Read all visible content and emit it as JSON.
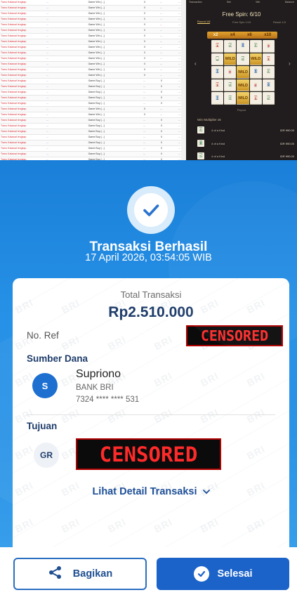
{
  "transaction_table": {
    "rows": [
      {
        "user": "Trans Kalawat lengkap",
        "id": "...",
        "ket": "Game Win [...]",
        "a": "0",
        "b": "...",
        "c": "...",
        "neg": false
      },
      {
        "user": "Trans Kalawat lengkap",
        "id": "...",
        "ket": "Game Win [...]",
        "a": "0",
        "b": "...",
        "c": "...",
        "neg": false
      },
      {
        "user": "Trans Kalawat lengkap",
        "id": "...",
        "ket": "Game Win [...]",
        "a": "0",
        "b": "...",
        "c": "...",
        "neg": false
      },
      {
        "user": "Trans Kalawat lengkap",
        "id": "...",
        "ket": "Game Win [...]",
        "a": "0",
        "b": "...",
        "c": "...",
        "neg": false
      },
      {
        "user": "Trans Kalawat lengkap",
        "id": "...",
        "ket": "Game Win [...]",
        "a": "0",
        "b": "...",
        "c": "...",
        "neg": true
      },
      {
        "user": "Trans Kalawat lengkap",
        "id": "...",
        "ket": "Game Win [...]",
        "a": "0",
        "b": "...",
        "c": "...",
        "neg": false
      },
      {
        "user": "Trans Kalawat lengkap",
        "id": "...",
        "ket": "Game Win [...]",
        "a": "0",
        "b": "...",
        "c": "...",
        "neg": false
      },
      {
        "user": "Trans Kalawat lengkap",
        "id": "...",
        "ket": "Game Win [...]",
        "a": "0",
        "b": "...",
        "c": "...",
        "neg": false
      },
      {
        "user": "Trans Kalawat lengkap",
        "id": "...",
        "ket": "Game Win [...]",
        "a": "0",
        "b": "...",
        "c": "...",
        "neg": false
      },
      {
        "user": "Trans Kalawat lengkap",
        "id": "...",
        "ket": "Game Win [...]",
        "a": "0",
        "b": "...",
        "c": "...",
        "neg": false
      },
      {
        "user": "Trans Kalawat lengkap",
        "id": "...",
        "ket": "Game Win [...]",
        "a": "0",
        "b": "...",
        "c": "...",
        "neg": true
      },
      {
        "user": "Trans Kalawat lengkap",
        "id": "...",
        "ket": "Game Win [...]",
        "a": "0",
        "b": "...",
        "c": "...",
        "neg": false
      },
      {
        "user": "Trans Kalawat lengkap",
        "id": "...",
        "ket": "Game Win [...]",
        "a": "0",
        "b": "...",
        "c": "...",
        "neg": false
      },
      {
        "user": "Trans Kalawat lengkap",
        "id": "...",
        "ket": "Game Win [...]",
        "a": "0",
        "b": "...",
        "c": "...",
        "neg": false
      },
      {
        "user": "Trans Kalawat lengkap",
        "id": "...",
        "ket": "Game Buy [...]",
        "a": "...",
        "b": "0",
        "c": "...",
        "neg": false
      },
      {
        "user": "Trans Kalawat lengkap",
        "id": "...",
        "ket": "Game Buy [...]",
        "a": "...",
        "b": "0",
        "c": "...",
        "neg": false
      },
      {
        "user": "Trans Kalawat lengkap",
        "id": "...",
        "ket": "Game Buy [...]",
        "a": "...",
        "b": "0",
        "c": "...",
        "neg": false
      },
      {
        "user": "Trans Kalawat lengkap",
        "id": "...",
        "ket": "Game Buy [...]",
        "a": "...",
        "b": "0",
        "c": "...",
        "neg": false
      },
      {
        "user": "Trans Kalawat lengkap",
        "id": "...",
        "ket": "Game Buy [...]",
        "a": "...",
        "b": "0",
        "c": "...",
        "neg": false
      },
      {
        "user": "Trans Kalawat lengkap",
        "id": "...",
        "ket": "Game Win [...]",
        "a": "0",
        "b": "...",
        "c": "...",
        "neg": false
      },
      {
        "user": "Trans Kalawat lengkap",
        "id": "...",
        "ket": "Game Win [...]",
        "a": "0",
        "b": "...",
        "c": "...",
        "neg": false
      },
      {
        "user": "Trans Kalawat lengkap",
        "id": "...",
        "ket": "Game Buy [...]",
        "a": "...",
        "b": "0",
        "c": "...",
        "neg": false
      },
      {
        "user": "Trans Kalawat lengkap",
        "id": "...",
        "ket": "Game Buy [...]",
        "a": "...",
        "b": "0",
        "c": "...",
        "neg": false
      },
      {
        "user": "Trans Kalawat lengkap",
        "id": "...",
        "ket": "Game Buy [...]",
        "a": "...",
        "b": "0",
        "c": "...",
        "neg": false
      },
      {
        "user": "Trans Kalawat lengkap",
        "id": "...",
        "ket": "Game Buy [...]",
        "a": "...",
        "b": "0",
        "c": "...",
        "neg": false
      },
      {
        "user": "Trans Kalawat lengkap",
        "id": "...",
        "ket": "Game Buy [...]",
        "a": "...",
        "b": "0",
        "c": "...",
        "neg": false
      },
      {
        "user": "Trans Kalawat lengkap",
        "id": "...",
        "ket": "Game Buy [...]",
        "a": "...",
        "b": "0",
        "c": "...",
        "neg": false
      },
      {
        "user": "Trans Kalawat lengkap",
        "id": "...",
        "ket": "Game Buy [...]",
        "a": "...",
        "b": "0",
        "c": "...",
        "neg": false
      },
      {
        "user": "Trans Kalawat lengkap",
        "id": "...",
        "ket": "Game Buy [...]",
        "a": "...",
        "b": "0",
        "c": "...",
        "neg": false
      },
      {
        "user": "Trans Kalawat lengkap",
        "id": "...",
        "ket": "Game Buy [...]",
        "a": "...",
        "b": "0",
        "c": "...",
        "neg": false
      }
    ]
  },
  "game": {
    "stats": [
      "Transaction",
      "Bet",
      "Win",
      "Balance"
    ],
    "title": "Free Spin: 6/10",
    "tabs": [
      "Round 1/6",
      "Free Spin 1/10",
      "Result 1/3"
    ],
    "multipliers": [
      "x2",
      "x4",
      "x6",
      "x10"
    ],
    "tiles": [
      "🀇",
      "🀐",
      "🀙",
      "🀅",
      "🀄",
      "🀆",
      "WILD",
      "🀐",
      "WILD",
      "🀇",
      "🀚",
      "🀄",
      "WILD",
      "🀙",
      "🀅",
      "🀇",
      "🀐",
      "WILD",
      "🀄",
      "🀙",
      "🀚",
      "🀅",
      "WILD",
      "🀇",
      "🀐"
    ],
    "payout_label": "Payout",
    "win_title": "Win Multiplier x6",
    "wins": [
      {
        "icon": "🀅",
        "name": "4 of a Kind",
        "amount": "IDR 990.00"
      },
      {
        "icon": "🀙",
        "name": "4 of a Kind",
        "amount": "IDR 990.00"
      },
      {
        "icon": "🀐",
        "name": "4 of a Kind",
        "amount": "IDR 990.00"
      }
    ]
  },
  "receipt": {
    "title": "Transaksi Berhasil",
    "datetime": "17 April 2026, 03:54:05 WIB",
    "total_label": "Total Transaksi",
    "total_amount": "Rp2.510.000",
    "noref_label": "No. Ref",
    "censored_label": "CENSORED",
    "source_title": "Sumber Dana",
    "source_initial": "S",
    "source_name": "Supriono",
    "source_bank": "BANK BRI",
    "source_account": "7324 **** **** 531",
    "dest_title": "Tujuan",
    "dest_initial": "GR",
    "detail_link": "Lihat Detail Transaksi",
    "share_label": "Bagikan",
    "done_label": "Selesai",
    "watermark": "BRI"
  },
  "colors": {
    "brand_blue": "#1b63c9",
    "header_gradient_top": "#1a7fd8",
    "censor_red": "#ff2a2a"
  }
}
